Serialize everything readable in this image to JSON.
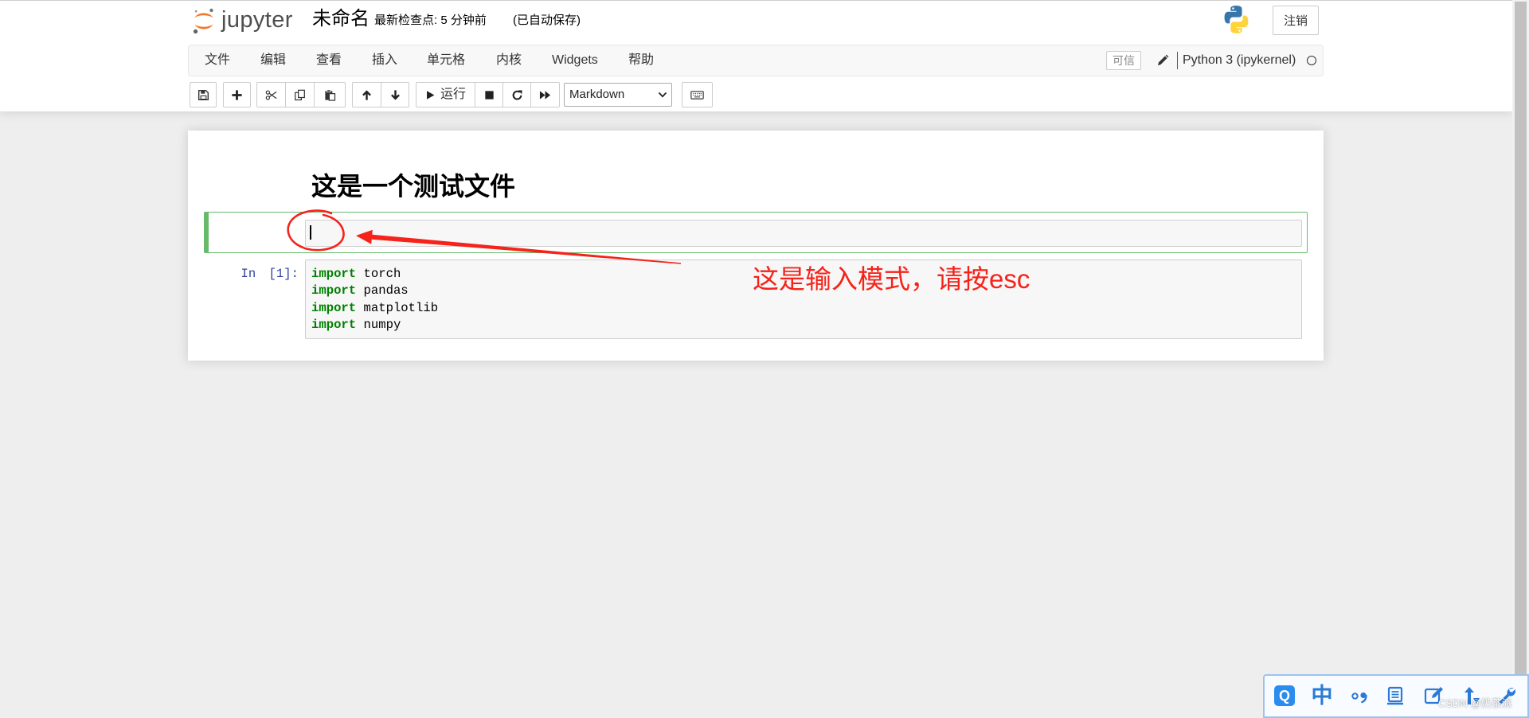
{
  "header": {
    "logo_text": "jupyter",
    "notebook_name": "未命名",
    "checkpoint": "最新检查点: 5 分钟前",
    "autosave": "(已自动保存)",
    "logout_label": "注销"
  },
  "menubar": {
    "items": [
      "文件",
      "编辑",
      "查看",
      "插入",
      "单元格",
      "内核",
      "Widgets",
      "帮助"
    ],
    "trusted_label": "可信",
    "kernel_name": "Python 3 (ipykernel)"
  },
  "toolbar": {
    "run_label": "运行",
    "cell_type": "Markdown"
  },
  "notebook": {
    "markdown_heading": "这是一个测试文件",
    "code_cell": {
      "prompt": "In [1]:",
      "lines": [
        {
          "keyword": "import",
          "name": "torch"
        },
        {
          "keyword": "import",
          "name": "pandas"
        },
        {
          "keyword": "import",
          "name": "matplotlib"
        },
        {
          "keyword": "import",
          "name": "numpy"
        }
      ]
    }
  },
  "annotation": {
    "text": "这是输入模式，请按esc",
    "color": "#f5231a"
  },
  "ime_toolbar": {
    "brand_label": "Q",
    "language_label": "中"
  },
  "watermark": "CSDN @奶茶派",
  "icons": {
    "logo": "jupyter-logo-icon",
    "kernel_logo": "python-logo-icon",
    "edit_notebook_metadata": "pencil-icon",
    "kernel_indicator": "kernel-idle-circle-icon",
    "toolbar": [
      "save-icon",
      "plus-icon",
      "cut-icon",
      "copy-icon",
      "paste-icon",
      "arrow-up-icon",
      "arrow-down-icon",
      "play-icon",
      "stop-icon",
      "restart-icon",
      "fast-forward-icon",
      "keyboard-icon"
    ],
    "select_arrow": "chevron-down-icon",
    "ime": [
      "punctuation-icon",
      "soft-keyboard-icon",
      "edit-icon",
      "skin-icon",
      "wrench-icon"
    ]
  },
  "colors": {
    "page_background": "#eeeeee",
    "jupyter_orange": "#f37726",
    "edit_mode_green": "#66bb6a",
    "prompt_blue": "#303f9f",
    "keyword_green": "#008000",
    "input_background": "#f7f7f7",
    "ime_blue": "#2a7ad8"
  }
}
